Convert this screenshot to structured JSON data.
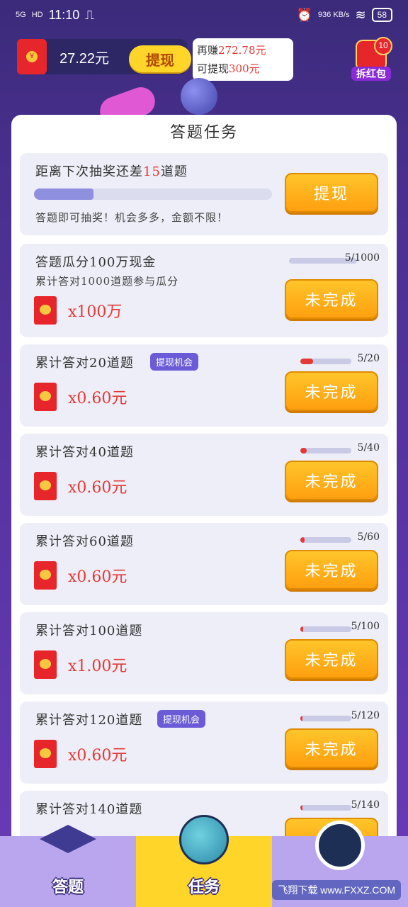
{
  "status_bar": {
    "network": "5G",
    "hd": "HD",
    "time": "11:10",
    "speed": "936 KB/s",
    "battery": "58"
  },
  "wallet": {
    "balance": "27.22元",
    "withdraw_label": "提现"
  },
  "tip": {
    "line1_prefix": "再赚",
    "line1_amount": "272.78元",
    "line2_prefix": "可提现",
    "line2_amount": "300元"
  },
  "red_packet": {
    "badge": "10",
    "label": "拆红包"
  },
  "card": {
    "title": "答题任务",
    "lottery": {
      "title_prefix": "距离下次抽奖还差",
      "title_count": "15",
      "title_suffix": "道题",
      "progress": 0.25,
      "sub": "答题即可抽奖！机会多多，金额不限！",
      "button": "提现"
    },
    "tasks": [
      {
        "title": "答题瓜分100万现金",
        "sub": "累计答对1000道题参与瓜分",
        "reward": "x100万",
        "progress_text": "5/1000",
        "progress": 0.005,
        "button": "未完成",
        "chip": ""
      },
      {
        "title": "累计答对20道题",
        "reward": "x0.60元",
        "progress_text": "5/20",
        "progress": 0.25,
        "button": "未完成",
        "chip": "提现机会"
      },
      {
        "title": "累计答对40道题",
        "reward": "x0.60元",
        "progress_text": "5/40",
        "progress": 0.125,
        "button": "未完成",
        "chip": ""
      },
      {
        "title": "累计答对60道题",
        "reward": "x0.60元",
        "progress_text": "5/60",
        "progress": 0.083,
        "button": "未完成",
        "chip": ""
      },
      {
        "title": "累计答对100道题",
        "reward": "x1.00元",
        "progress_text": "5/100",
        "progress": 0.05,
        "button": "未完成",
        "chip": ""
      },
      {
        "title": "累计答对120道题",
        "reward": "x0.60元",
        "progress_text": "5/120",
        "progress": 0.042,
        "button": "未完成",
        "chip": "提现机会"
      },
      {
        "title": "累计答对140道题",
        "reward": "",
        "progress_text": "5/140",
        "progress": 0.036,
        "button": "",
        "chip": ""
      }
    ]
  },
  "nav": {
    "items": [
      {
        "label": "答题",
        "icon": "graduation-cap-icon"
      },
      {
        "label": "任务",
        "icon": "planet-icon"
      },
      {
        "label": "",
        "icon": "astronaut-icon"
      }
    ]
  },
  "watermark": "飞翔下载 www.FXXZ.COM"
}
